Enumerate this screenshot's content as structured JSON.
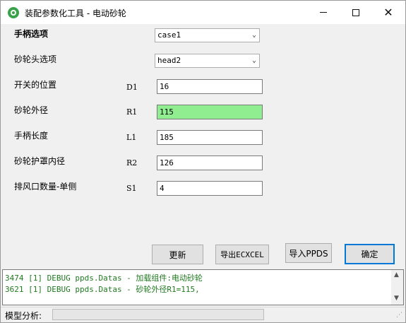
{
  "window": {
    "title": "装配参数化工具 - 电动砂轮"
  },
  "form": {
    "handle_option": {
      "label": "手柄选项",
      "value": "case1"
    },
    "wheel_head_option": {
      "label": "砂轮头选项",
      "value": "head2"
    },
    "rows": [
      {
        "label": "开关的位置",
        "code": "D1",
        "value": "16"
      },
      {
        "label": "砂轮外径",
        "code": "R1",
        "value": "115"
      },
      {
        "label": "手柄长度",
        "code": "L1",
        "value": "185"
      },
      {
        "label": "砂轮护罩内径",
        "code": "R2",
        "value": "126"
      },
      {
        "label": "排风口数量-单侧",
        "code": "S1",
        "value": "4"
      }
    ]
  },
  "buttons": {
    "update": "更新",
    "export": "导出ECXCEL",
    "import": "导入PPDS",
    "confirm": "确定"
  },
  "log": {
    "lines": [
      "3474 [1] DEBUG ppds.Datas - 加载组件:电动砂轮",
      "3621 [1] DEBUG ppds.Datas - 砂轮外径R1=115,"
    ]
  },
  "status": {
    "label": "模型分析:",
    "progress": 0
  },
  "colors": {
    "highlight_field": "#90ee90",
    "log_text": "#1f7a1f",
    "primary_border": "#0078d7"
  }
}
